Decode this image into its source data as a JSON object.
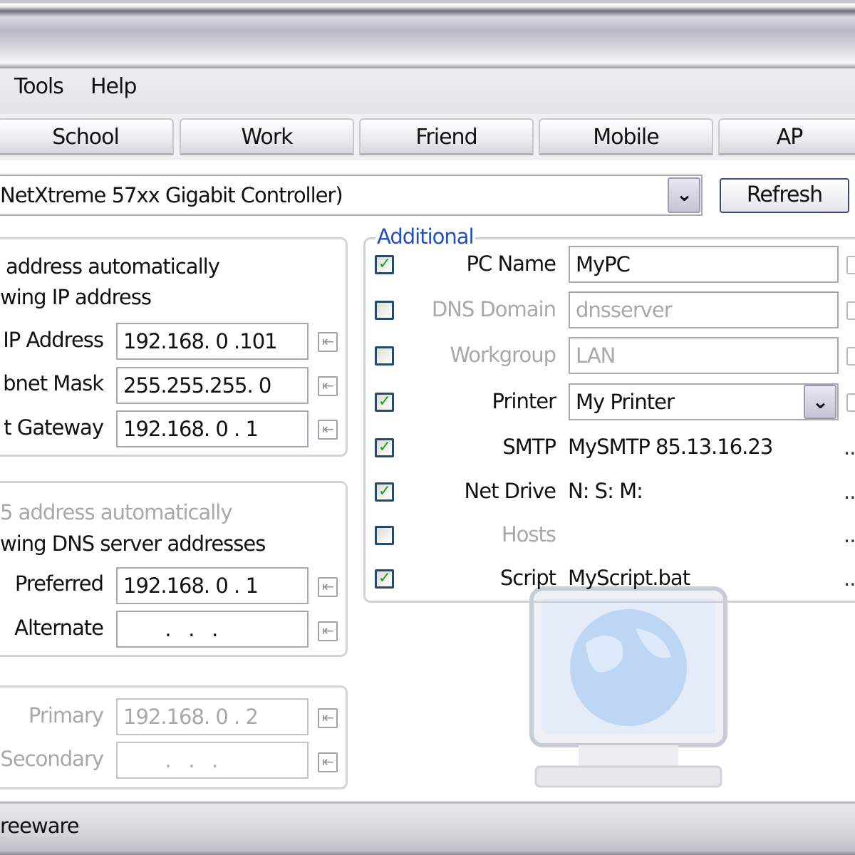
{
  "menu": {
    "tools": "Tools",
    "help": "Help"
  },
  "tabs": [
    "School",
    "Work",
    "Friend",
    "Mobile",
    "AP"
  ],
  "adapter": {
    "value": "NetXtreme 57xx Gigabit Controller)",
    "refresh": "Refresh"
  },
  "ip_group": {
    "auto": "address automatically",
    "manual": "wing IP address",
    "rows": [
      {
        "label": "IP Address",
        "value": "192.168. 0 .101"
      },
      {
        "label": "bnet Mask",
        "value": "255.255.255. 0"
      },
      {
        "label": "t Gateway",
        "value": "192.168. 0 . 1"
      }
    ]
  },
  "dns_group": {
    "auto": "5 address automatically",
    "manual": "wing DNS server addresses",
    "rows": [
      {
        "label": "Preferred",
        "value": "192.168. 0 . 1"
      },
      {
        "label": "Alternate",
        "value": "  .   .   ."
      }
    ]
  },
  "wins_group": {
    "rows": [
      {
        "label": "Primary",
        "value": "192.168. 0 . 2"
      },
      {
        "label": "Secondary",
        "value": "  .   .   ."
      }
    ]
  },
  "additional": {
    "title": "Additional",
    "rows": [
      {
        "label": "PC Name",
        "value": "MyPC",
        "checked": true
      },
      {
        "label": "DNS Domain",
        "value": "dnsserver",
        "checked": false
      },
      {
        "label": "Workgroup",
        "value": "LAN",
        "checked": false
      },
      {
        "label": "Printer",
        "value": "My Printer",
        "checked": true
      },
      {
        "label": "SMTP",
        "value": "MySMTP 85.13.16.23",
        "checked": true
      },
      {
        "label": "Net Drive",
        "value": "N: S: M:",
        "checked": true
      },
      {
        "label": "Hosts",
        "value": "",
        "checked": false
      },
      {
        "label": "Script",
        "value": "MyScript.bat",
        "checked": true
      }
    ],
    "more": ".."
  },
  "status": {
    "text": "reeware"
  },
  "colors": {
    "accent": "#2050c0",
    "check": "#21a121"
  }
}
